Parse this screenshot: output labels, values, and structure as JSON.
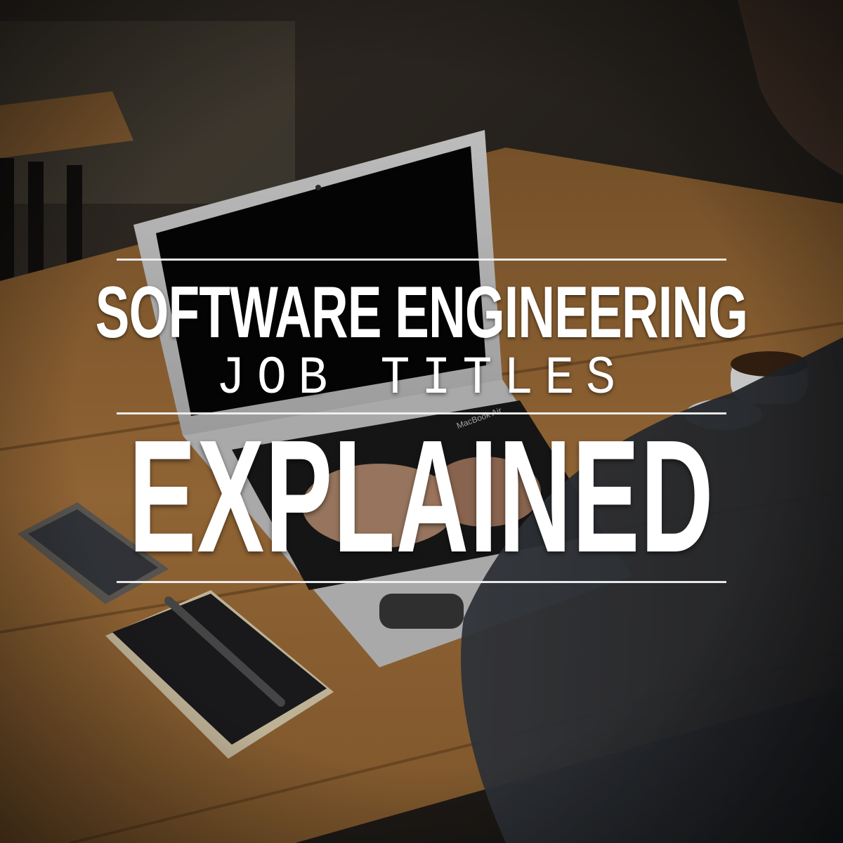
{
  "title": {
    "line1": "SOFTWARE ENGINEERING",
    "line2": "JOB TITLES",
    "line3": "EXPLAINED"
  },
  "laptop_brand": "MacBook Air",
  "colors": {
    "title_text": "#ffffff",
    "rules": "#f2f2f2",
    "table_wood": "#b07a40",
    "laptop_silver": "#d8d8d8",
    "screen_black": "#050505",
    "background_dark": "#2a2520"
  }
}
